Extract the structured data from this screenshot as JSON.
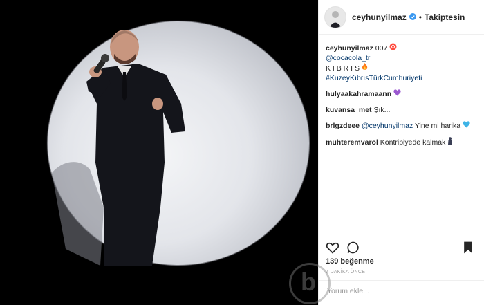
{
  "header": {
    "username": "ceyhunyilmaz",
    "separator": "•",
    "follow_label": "Takiptesin"
  },
  "caption": {
    "username": "ceyhunyilmaz",
    "text": "007",
    "mention": "@cocacola_tr",
    "line3": "K I B R I S",
    "hashtag": "#KuzeyKıbrısTürkCumhuriyeti"
  },
  "comments": [
    {
      "username": "hulyaakahramaann",
      "text": ""
    },
    {
      "username": "kuvansa_met",
      "text": "Şık..."
    },
    {
      "username": "brlgzdeee",
      "mention": "@ceyhunyilmaz",
      "text": " Yine mi harika"
    },
    {
      "username": "muhteremvarol",
      "text": "Kontripiyede kalmak"
    }
  ],
  "likes": "139 beğenme",
  "timestamp": "7 DAKİKA ÖNCE",
  "comment_input": {
    "placeholder": "Yorum ekle..."
  },
  "colors": {
    "verified": "#3897f0",
    "link": "#003569",
    "text": "#262626"
  },
  "icons": [
    "verified-badge-icon",
    "record-icon",
    "fire-icon",
    "purple-heart-icon",
    "blue-heart-icon",
    "person-icon",
    "heart-icon",
    "comment-icon",
    "bookmark-icon"
  ]
}
